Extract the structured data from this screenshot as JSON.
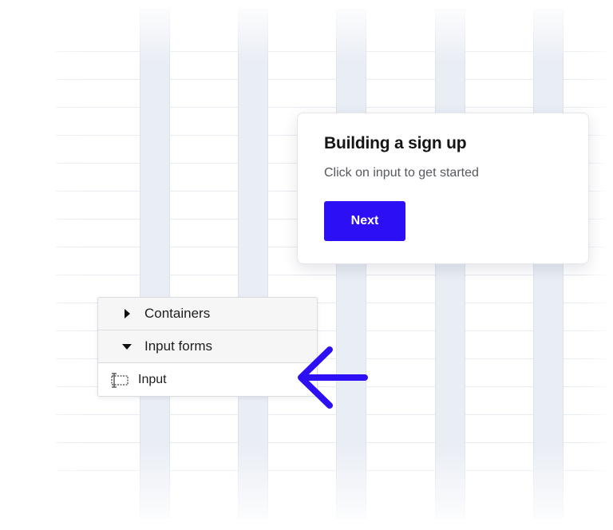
{
  "card": {
    "title": "Building a sign up",
    "body": "Click on input to get started",
    "next_label": "Next"
  },
  "tree": {
    "items": [
      {
        "label": "Containers",
        "state": "collapsed",
        "icon": "caret-right-icon"
      },
      {
        "label": "Input forms",
        "state": "expanded",
        "icon": "caret-down-icon"
      },
      {
        "label": "Input",
        "state": "leaf",
        "icon": "input-field-icon"
      }
    ]
  },
  "colors": {
    "accent": "#2d0ff5",
    "grid_column": "#e9edf4",
    "grid_line": "#e8ebf1",
    "text": "#151515"
  },
  "icons": {
    "pointer": "arrow-left-icon"
  }
}
